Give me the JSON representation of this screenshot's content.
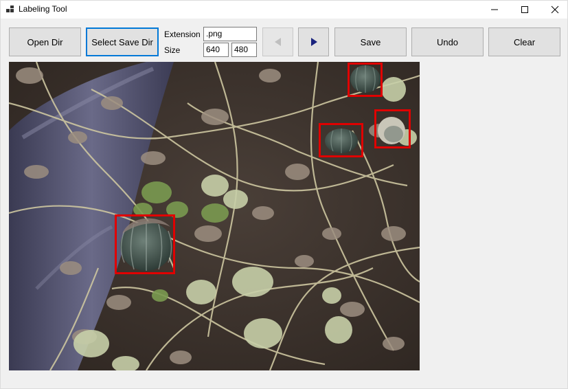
{
  "window": {
    "title": "Labeling Tool"
  },
  "toolbar": {
    "open_dir_label": "Open Dir",
    "select_save_dir_label": "Select Save Dir",
    "extension_label": "Extension",
    "extension_value": ".png",
    "size_label": "Size",
    "width_value": "640",
    "height_value": "480",
    "prev_icon": "prev-arrow-icon",
    "next_icon": "next-arrow-icon",
    "save_label": "Save",
    "undo_label": "Undo",
    "clear_label": "Clear"
  },
  "image": {
    "subject": "pumpkins in field",
    "box_color": "#e00000",
    "annotation_count": 4
  },
  "colors": {
    "next_arrow": "#1a237e",
    "prev_arrow_disabled": "#bfbfbf",
    "focus_border": "#0078d7"
  }
}
